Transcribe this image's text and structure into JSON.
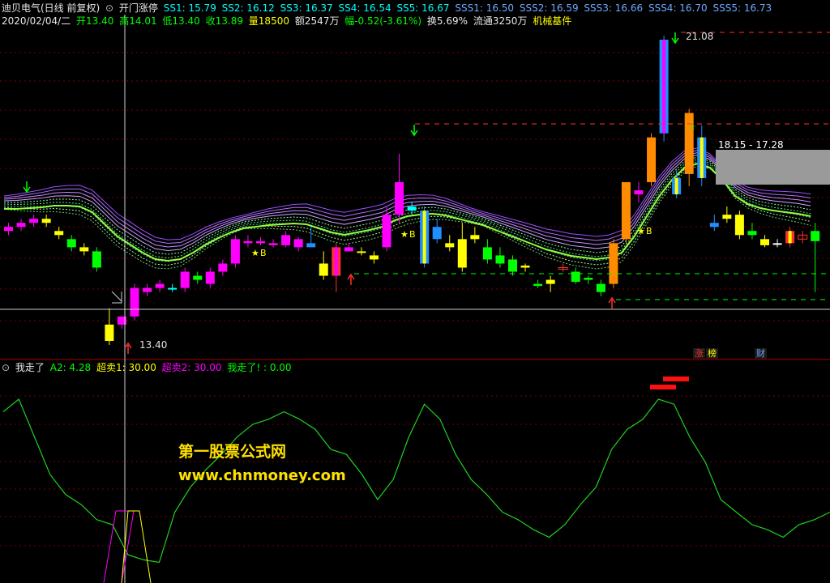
{
  "header1": {
    "stock_name": "迪贝电气(日线 前复权)",
    "circle_icon": "circle-down-icon",
    "indicator_name": "开门涨停",
    "ss1": "SS1: 15.79",
    "ss2": "SS2: 16.12",
    "ss3": "SS3: 16.37",
    "ss4": "SS4: 16.54",
    "ss5": "SS5: 16.67",
    "sss1": "SSS1: 16.50",
    "sss2": "SSS2: 16.59",
    "sss3": "SSS3: 16.66",
    "sss4": "SSS4: 16.70",
    "sss5": "SSS5: 16.73"
  },
  "header2": {
    "date": "2020/02/04/二",
    "open": "开13.40",
    "high": "高14.01",
    "low": "低13.40",
    "close": "收13.89",
    "volume": "量18500",
    "amount": "额2547万",
    "change": "幅-0.52(-3.61%)",
    "turnover": "换5.69%",
    "float": "流通3250万",
    "sector": "机械基件"
  },
  "price_labels": {
    "high_label": "21.08",
    "low_label": "13.40",
    "range_label": "18.15 - 17.28"
  },
  "badges": {
    "zhang": "涨",
    "bang": "榜",
    "cai": "财"
  },
  "lower_header": {
    "name": "我走了",
    "a2": "A2: 4.28",
    "chaomai1": "超卖1: 30.00",
    "chaomai2": "超卖2: 30.00",
    "wozoule": "我走了! : 0.00"
  },
  "watermark": {
    "line1": "第一股票公式网",
    "line2": "www.chnmoney.com"
  },
  "colors": {
    "up": "#ff3030",
    "down": "#00ff00",
    "magenta": "#ff00ff",
    "yellow": "#ffff00",
    "orange": "#ff8c00",
    "blue": "#1e90ff",
    "cyan": "#00ffff"
  },
  "chart_data": {
    "type": "candlestick",
    "candles": [
      {
        "o": 16.3,
        "h": 16.4,
        "l": 16.1,
        "c": 16.2,
        "color": "magenta"
      },
      {
        "o": 16.4,
        "h": 16.5,
        "l": 16.2,
        "c": 16.3,
        "color": "magenta"
      },
      {
        "o": 16.5,
        "h": 16.6,
        "l": 16.3,
        "c": 16.4,
        "color": "magenta"
      },
      {
        "o": 16.5,
        "h": 16.6,
        "l": 16.3,
        "c": 16.4,
        "color": "yellow"
      },
      {
        "o": 16.2,
        "h": 16.3,
        "l": 16.0,
        "c": 16.1,
        "color": "yellow"
      },
      {
        "o": 16.0,
        "h": 16.1,
        "l": 15.7,
        "c": 15.8,
        "color": "green"
      },
      {
        "o": 15.8,
        "h": 15.9,
        "l": 15.6,
        "c": 15.7,
        "color": "yellow"
      },
      {
        "o": 15.7,
        "h": 15.8,
        "l": 15.2,
        "c": 15.3,
        "color": "green"
      },
      {
        "o": 13.5,
        "h": 14.3,
        "l": 13.4,
        "c": 13.9,
        "color": "yellow"
      },
      {
        "o": 13.9,
        "h": 14.1,
        "l": 13.8,
        "c": 14.1,
        "color": "magenta"
      },
      {
        "o": 14.1,
        "h": 14.9,
        "l": 14.0,
        "c": 14.8,
        "color": "magenta"
      },
      {
        "o": 14.7,
        "h": 14.9,
        "l": 14.6,
        "c": 14.8,
        "color": "magenta"
      },
      {
        "o": 14.8,
        "h": 15.0,
        "l": 14.7,
        "c": 14.9,
        "color": "magenta"
      },
      {
        "o": 14.8,
        "h": 14.9,
        "l": 14.7,
        "c": 14.8,
        "color": "cyan"
      },
      {
        "o": 14.8,
        "h": 15.3,
        "l": 14.7,
        "c": 15.2,
        "color": "magenta"
      },
      {
        "o": 15.1,
        "h": 15.2,
        "l": 14.9,
        "c": 15.0,
        "color": "green"
      },
      {
        "o": 14.9,
        "h": 15.3,
        "l": 14.8,
        "c": 15.2,
        "color": "magenta"
      },
      {
        "o": 15.2,
        "h": 15.5,
        "l": 15.1,
        "c": 15.4,
        "color": "magenta"
      },
      {
        "o": 15.4,
        "h": 16.1,
        "l": 15.3,
        "c": 16.0,
        "color": "magenta"
      },
      {
        "o": 15.9,
        "h": 16.1,
        "l": 15.8,
        "c": 15.95,
        "color": "magenta"
      },
      {
        "o": 15.95,
        "h": 16.05,
        "l": 15.85,
        "c": 15.9,
        "color": "magenta"
      },
      {
        "o": 15.9,
        "h": 16.0,
        "l": 15.8,
        "c": 15.85,
        "color": "magenta"
      },
      {
        "o": 15.85,
        "h": 16.2,
        "l": 15.8,
        "c": 16.1,
        "color": "magenta"
      },
      {
        "o": 16.0,
        "h": 16.05,
        "l": 15.7,
        "c": 15.8,
        "color": "magenta"
      },
      {
        "o": 15.9,
        "h": 16.3,
        "l": 15.85,
        "c": 15.8,
        "color": "blue"
      },
      {
        "o": 15.4,
        "h": 15.7,
        "l": 15.0,
        "c": 15.1,
        "color": "yellow"
      },
      {
        "o": 15.8,
        "h": 15.9,
        "l": 14.7,
        "c": 15.1,
        "color": "red_magenta"
      },
      {
        "o": 15.8,
        "h": 15.9,
        "l": 15.7,
        "c": 15.7,
        "color": "magenta"
      },
      {
        "o": 15.7,
        "h": 15.8,
        "l": 15.6,
        "c": 15.7,
        "color": "yellow"
      },
      {
        "o": 15.5,
        "h": 15.7,
        "l": 15.4,
        "c": 15.6,
        "color": "yellow"
      },
      {
        "o": 15.8,
        "h": 16.8,
        "l": 15.7,
        "c": 16.6,
        "color": "magenta"
      },
      {
        "o": 16.6,
        "h": 18.1,
        "l": 16.4,
        "c": 17.4,
        "color": "magenta"
      },
      {
        "o": 16.8,
        "h": 16.9,
        "l": 16.6,
        "c": 16.7,
        "color": "cyan"
      },
      {
        "o": 16.7,
        "h": 16.8,
        "l": 15.3,
        "c": 15.4,
        "color": "blue_yellow"
      },
      {
        "o": 16.3,
        "h": 16.5,
        "l": 15.9,
        "c": 16.0,
        "color": "blue"
      },
      {
        "o": 15.9,
        "h": 16.1,
        "l": 15.7,
        "c": 15.8,
        "color": "yellow"
      },
      {
        "o": 16.0,
        "h": 16.4,
        "l": 15.2,
        "c": 15.3,
        "color": "yellow"
      },
      {
        "o": 16.1,
        "h": 16.3,
        "l": 15.9,
        "c": 16.0,
        "color": "yellow"
      },
      {
        "o": 15.8,
        "h": 16.0,
        "l": 15.4,
        "c": 15.5,
        "color": "green"
      },
      {
        "o": 15.6,
        "h": 15.8,
        "l": 15.3,
        "c": 15.4,
        "color": "green"
      },
      {
        "o": 15.5,
        "h": 15.6,
        "l": 15.1,
        "c": 15.2,
        "color": "green"
      },
      {
        "o": 15.3,
        "h": 15.4,
        "l": 15.2,
        "c": 15.35,
        "color": "yellow"
      },
      {
        "o": 14.9,
        "h": 15.0,
        "l": 14.8,
        "c": 14.85,
        "color": "green"
      },
      {
        "o": 14.9,
        "h": 15.1,
        "l": 14.7,
        "c": 15.0,
        "color": "yellow"
      },
      {
        "o": 15.3,
        "h": 15.4,
        "l": 15.2,
        "c": 15.3,
        "color": "red_line"
      },
      {
        "o": 15.2,
        "h": 15.3,
        "l": 14.9,
        "c": 14.95,
        "color": "green"
      },
      {
        "o": 15.0,
        "h": 15.1,
        "l": 14.9,
        "c": 15.05,
        "color": "green"
      },
      {
        "o": 14.9,
        "h": 15.0,
        "l": 14.6,
        "c": 14.7,
        "color": "green"
      },
      {
        "o": 14.9,
        "h": 16.0,
        "l": 14.8,
        "c": 15.9,
        "color": "orange"
      },
      {
        "o": 16.0,
        "h": 17.4,
        "l": 15.9,
        "c": 17.4,
        "color": "orange"
      },
      {
        "o": 17.2,
        "h": 17.4,
        "l": 16.9,
        "c": 17.1,
        "color": "magenta"
      },
      {
        "o": 17.4,
        "h": 18.6,
        "l": 17.3,
        "c": 18.5,
        "color": "orange"
      },
      {
        "o": 18.6,
        "h": 21.0,
        "l": 18.4,
        "c": 20.9,
        "color": "blue_magenta"
      },
      {
        "o": 17.1,
        "h": 17.7,
        "l": 17.0,
        "c": 17.5,
        "color": "blue_yellow"
      },
      {
        "o": 17.6,
        "h": 19.2,
        "l": 17.3,
        "c": 19.1,
        "color": "orange"
      },
      {
        "o": 18.5,
        "h": 18.8,
        "l": 17.3,
        "c": 17.5,
        "color": "blue_yellow"
      },
      {
        "o": 16.4,
        "h": 16.6,
        "l": 16.2,
        "c": 16.3,
        "color": "blue"
      },
      {
        "o": 16.6,
        "h": 16.8,
        "l": 16.4,
        "c": 16.5,
        "color": "yellow"
      },
      {
        "o": 16.6,
        "h": 16.7,
        "l": 16.0,
        "c": 16.1,
        "color": "yellow"
      },
      {
        "o": 16.2,
        "h": 16.4,
        "l": 16.0,
        "c": 16.1,
        "color": "green"
      },
      {
        "o": 16.0,
        "h": 16.1,
        "l": 15.8,
        "c": 15.85,
        "color": "yellow"
      },
      {
        "o": 15.9,
        "h": 16.0,
        "l": 15.8,
        "c": 15.9,
        "color": "white"
      },
      {
        "o": 15.9,
        "h": 16.3,
        "l": 15.8,
        "c": 16.2,
        "color": "red_yellow"
      },
      {
        "o": 16.1,
        "h": 16.2,
        "l": 15.9,
        "c": 16.0,
        "color": "red_line"
      },
      {
        "o": 16.2,
        "h": 16.4,
        "l": 14.7,
        "c": 15.95,
        "color": "green"
      }
    ],
    "oscillator": [
      65,
      70,
      55,
      40,
      32,
      28,
      22,
      20,
      8,
      6,
      5,
      25,
      35,
      42,
      48,
      55,
      60,
      62,
      65,
      62,
      58,
      50,
      48,
      40,
      30,
      38,
      55,
      68,
      62,
      48,
      38,
      32,
      25,
      22,
      18,
      15,
      20,
      28,
      35,
      50,
      58,
      62,
      70,
      68,
      55,
      45,
      30,
      25,
      20,
      18,
      15,
      20,
      22,
      25
    ]
  }
}
